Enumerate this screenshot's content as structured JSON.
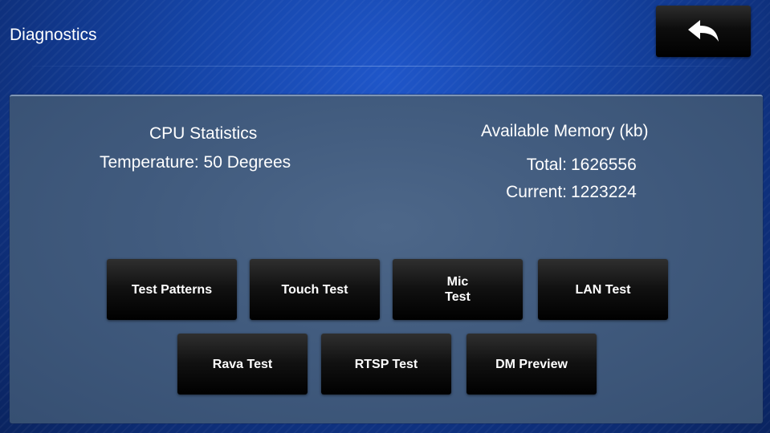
{
  "header": {
    "title": "Diagnostics",
    "back_icon": "back-arrow-icon"
  },
  "cpu": {
    "title": "CPU Statistics",
    "temperature": "Temperature: 50 Degrees"
  },
  "memory": {
    "title": "Available Memory (kb)",
    "total_label": "Total:",
    "total_value": "1626556",
    "current_label": "Current:",
    "current_value": "1223224"
  },
  "buttons": {
    "test_patterns": "Test Patterns",
    "touch_test": "Touch Test",
    "mic_test": "Mic\nTest",
    "lan_test": "LAN Test",
    "rava_test": "Rava Test",
    "rtsp_test": "RTSP Test",
    "dm_preview": "DM Preview"
  },
  "colors": {
    "background": "#1545a8",
    "panel": "#415b7e",
    "button": "#000000",
    "text": "#ffffff"
  }
}
